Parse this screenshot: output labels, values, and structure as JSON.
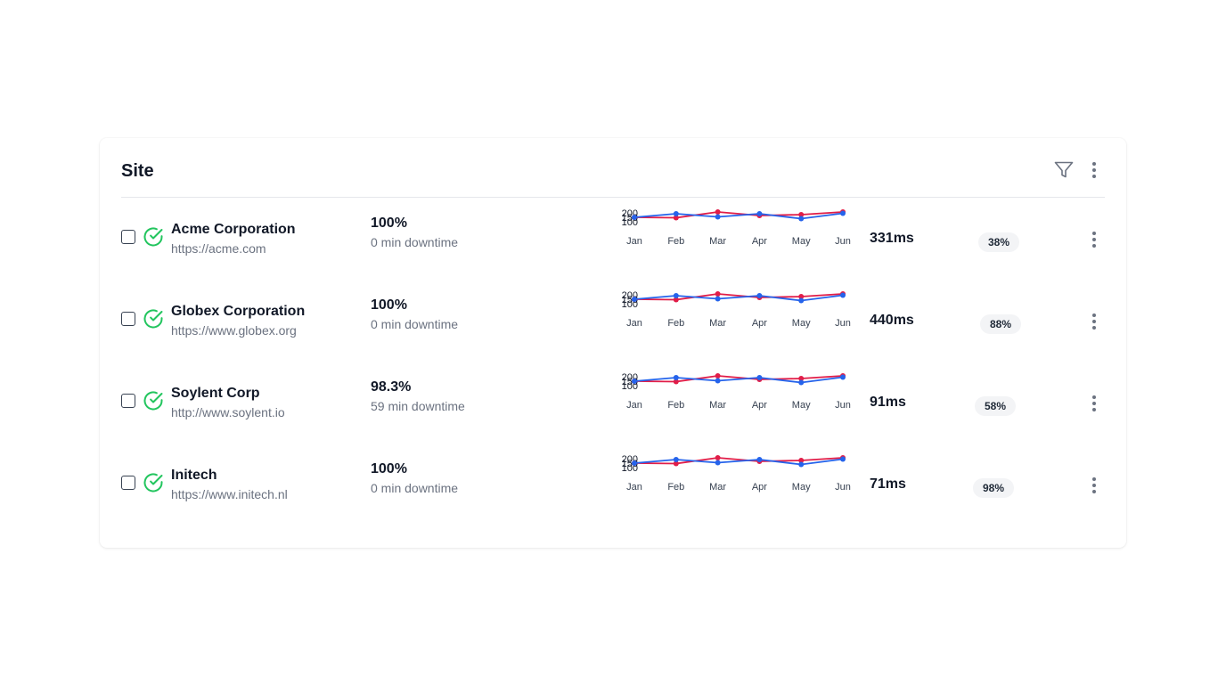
{
  "card": {
    "title": "Site",
    "actions": {
      "filter_icon": "filter-icon",
      "more_icon": "more-vertical-icon"
    }
  },
  "colors": {
    "series_a": "#e11d48",
    "series_b": "#2563eb",
    "status_ok": "#22c55e"
  },
  "rows": [
    {
      "name": "Acme Corporation",
      "url": "https://acme.com",
      "uptime": "100%",
      "downtime": "0 min downtime",
      "response_time": "331ms",
      "badge": "38%",
      "status_icon": "check-circle-icon"
    },
    {
      "name": "Globex Corporation",
      "url": "https://www.globex.org",
      "uptime": "100%",
      "downtime": "0 min downtime",
      "response_time": "440ms",
      "badge": "88%",
      "status_icon": "check-circle-icon"
    },
    {
      "name": "Soylent Corp",
      "url": "http://www.soylent.io",
      "uptime": "98.3%",
      "downtime": "59 min downtime",
      "response_time": "91ms",
      "badge": "58%",
      "status_icon": "check-circle-icon"
    },
    {
      "name": "Initech",
      "url": "https://www.initech.nl",
      "uptime": "100%",
      "downtime": "0 min downtime",
      "response_time": "71ms",
      "badge": "98%",
      "status_icon": "check-circle-icon"
    }
  ],
  "chart_data": {
    "type": "line",
    "categories": [
      "Jan",
      "Feb",
      "Mar",
      "Apr",
      "May",
      "Jun"
    ],
    "y_ticks": [
      "200",
      "150",
      "100"
    ],
    "ylim": [
      80,
      220
    ],
    "series": [
      {
        "values": [
          150,
          145,
          210,
          170,
          180,
          210
        ]
      },
      {
        "values": [
          150,
          190,
          155,
          190,
          135,
          195
        ]
      }
    ],
    "grid": false,
    "legend": "none"
  }
}
